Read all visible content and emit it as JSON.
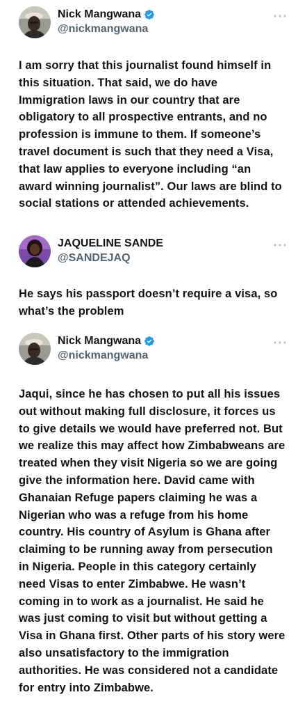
{
  "tweets": [
    {
      "display_name": "Nick Mangwana",
      "handle": "@nickmangwana",
      "verified": true,
      "avatar_icon": "profile-photo",
      "more_icon": "more-horizontal-icon",
      "text": "I am sorry that this journalist found himself in this situation. That said, we do have Immigration laws in our country that are obligatory to all prospective entrants, and no profession is immune to them. If someone’s travel document is such that they need a Visa, that law applies to everyone including “an award winning journalist”. Our laws are blind to social stations or attended achievements."
    },
    {
      "display_name": "JAQUELINE SANDE",
      "handle": "@SANDEJAQ",
      "verified": false,
      "avatar_icon": "profile-photo",
      "more_icon": "more-horizontal-icon",
      "text": "He says his passport doesn’t require a visa, so what’s the problem"
    },
    {
      "display_name": "Nick Mangwana",
      "handle": "@nickmangwana",
      "verified": true,
      "avatar_icon": "profile-photo",
      "more_icon": "more-horizontal-icon",
      "text": "Jaqui, since he has chosen to put all his issues out without making full disclosure, it forces us to give details we would have preferred not. But we realize this may affect how Zimbabweans are treated when they visit Nigeria so we are going give the information here. David came with Ghanaian Refuge papers claiming he was a Nigerian who was a refuge from his home country. His country of Asylum is Ghana after claiming to be running away from persecution in Nigeria. People in this category certainly need Visas to enter Zimbabwe. He wasn’t coming in to work as a journalist. He said he was just coming to visit but without getting a Visa in Ghana first. Other parts of his story were also unsatisfactory to the immigration authorities. He was considered not a candidate for entry into Zimbabwe."
    }
  ],
  "colors": {
    "text": "#0f1419",
    "handle": "#536471",
    "verified": "#1d9bf0",
    "more": "#b9c0c6"
  }
}
